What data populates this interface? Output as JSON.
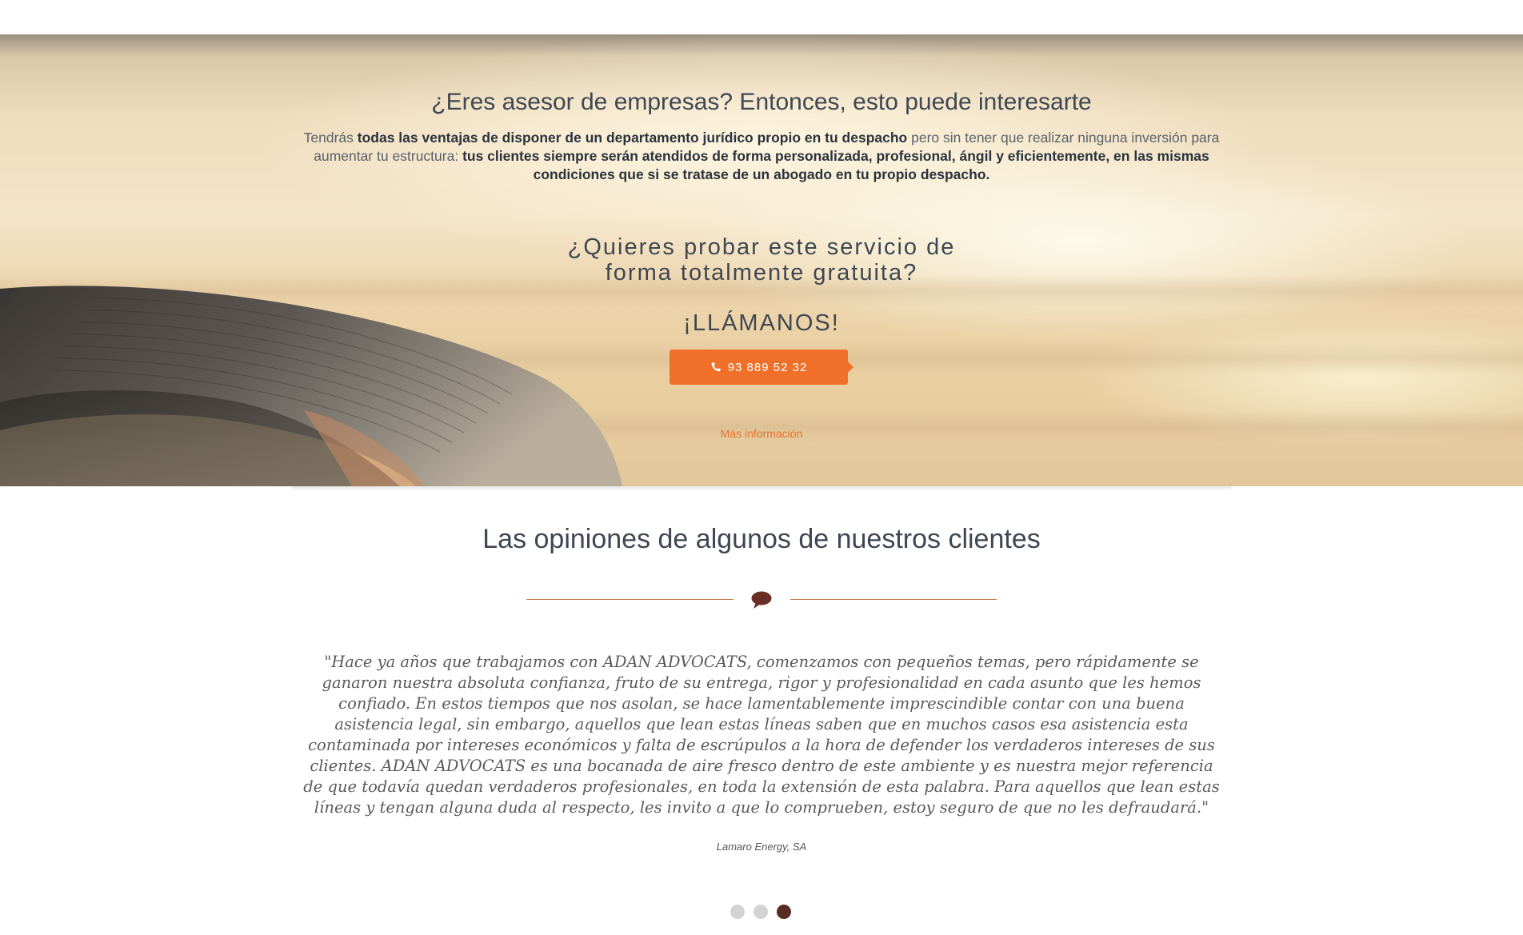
{
  "hero": {
    "title": "¿Eres asesor de empresas? Entonces, esto puede interesarte",
    "desc_1": "Tendrás ",
    "desc_bold_1": "todas las ventajas de disponer de un departamento jurídico propio en tu despacho",
    "desc_2": " pero sin tener que realizar ninguna inversión para aumentar tu estructura: ",
    "desc_bold_2": "tus clientes siempre serán atendidos de forma personalizada, profesional, ángil y eficientemente, en las mismas condiciones que si se tratase de un abogado en tu propio despacho.",
    "question_line_1": "¿Quieres probar este servicio de",
    "question_line_2": "forma totalmente gratuita?",
    "call_to_action": "¡LLÁMANOS!",
    "phone": "93 889 52 32",
    "phone_icon": "phone-icon",
    "more_info": "Más información",
    "accent_color": "#f0702a"
  },
  "testimonials": {
    "title": "Las opiniones de algunos de nuestros clientes",
    "divider_icon": "comment-icon",
    "quote": "\"Hace ya años que trabajamos con ADAN ADVOCATS, comenzamos con pequeños temas, pero rápidamente se ganaron nuestra absoluta confianza, fruto de su entrega, rigor y profesionalidad en cada asunto que les hemos confiado. En estos tiempos que nos asolan, se hace lamentablemente imprescindible contar con una buena asistencia legal, sin embargo, aquellos que lean estas líneas saben que en muchos casos esa asistencia esta contaminada por intereses económicos y falta de escrúpulos a la hora de defender los verdaderos intereses de sus clientes. ADAN ADVOCATS es una bocanada de aire fresco dentro de este ambiente y es nuestra mejor referencia de que todavía quedan verdaderos profesionales, en toda la extensión de esta palabra. Para aquellos que lean estas líneas y tengan alguna duda al respecto, les invito a que lo comprueben, estoy seguro de que no les defraudará.\"",
    "author": "Lamaro Energy, SA",
    "slide_count": 3,
    "active_slide": 3,
    "active_dot_color": "#5a2c26"
  }
}
